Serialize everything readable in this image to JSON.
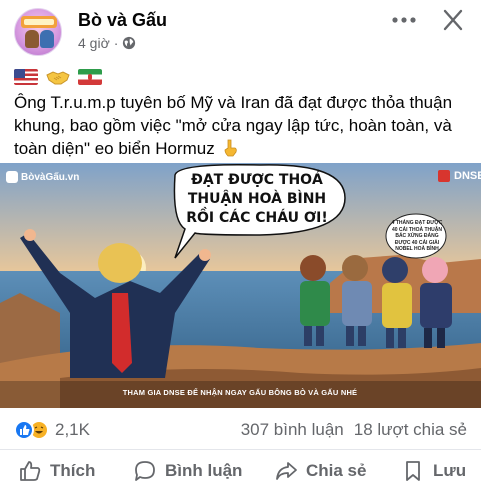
{
  "post": {
    "page_name": "Bò và Gấu",
    "time": "4 giờ",
    "separator": "·",
    "text": "Ông T.r.u.m.p tuyên bố Mỹ và Iran đã đạt được thỏa thuận khung, bao gồm việc \"mở cửa ngay lập tức, hoàn toàn, và toàn diện\" eo biển Hormuz",
    "icons": [
      "us-flag-icon",
      "handshake-icon",
      "iran-flag-icon",
      "pointing-down-icon"
    ],
    "avatar_logo_text": "BÒ & GẤU"
  },
  "image": {
    "brand": "BòvàGấu.vn",
    "sponsor": "DNSE",
    "speech_main": "ĐẠT ĐƯỢC THOẢ THUẬN HOÀ BÌNH RỒI CÁC CHÁU ƠI!",
    "speech_small": "4 THÁNG ĐẠT ĐƯỢC 40 CÁI THOẢ THUẬN BÁC XỨNG ĐÁNG ĐƯỢC 40 CÁI GIẢI NOBEL HOÀ BÌNH",
    "footer": "THAM GIA DNSE ĐỂ NHẬN NGAY GẤU BÔNG BÒ VÀ GẤU NHÉ"
  },
  "stats": {
    "reaction_count": "2,1K",
    "comments": "307 bình luận",
    "shares": "18 lượt chia sẻ"
  },
  "actions": {
    "like": "Thích",
    "comment": "Bình luận",
    "share": "Chia sẻ",
    "save": "Lưu"
  },
  "colors": {
    "like_blue": "#1877f2",
    "haha_yellow": "#f7b125",
    "secondary_text": "#65676b"
  }
}
